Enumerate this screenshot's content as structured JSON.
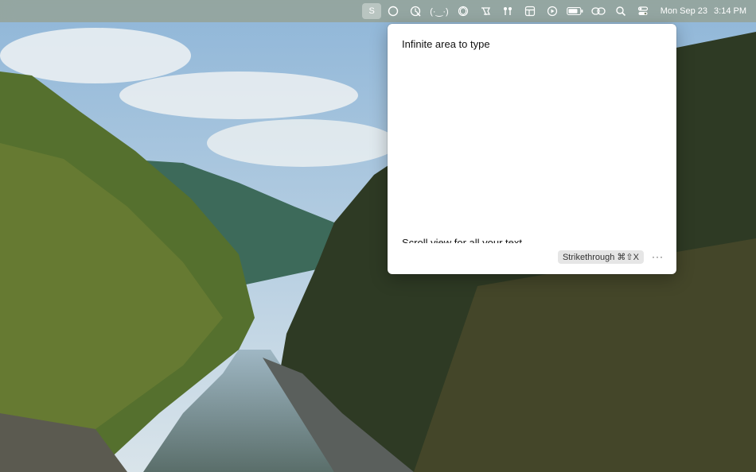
{
  "menubar": {
    "items": [
      {
        "icon": "s-app-icon",
        "label": "S",
        "active": true
      },
      {
        "icon": "circle-icon"
      },
      {
        "icon": "cursor-clock-icon"
      },
      {
        "icon": "ascii-face-icon",
        "label": "(·‿·)"
      },
      {
        "icon": "openai-icon"
      },
      {
        "icon": "flag-icon"
      },
      {
        "icon": "airpods-icon"
      },
      {
        "icon": "window-grid-icon"
      },
      {
        "icon": "play-circle-icon"
      },
      {
        "icon": "battery-icon"
      },
      {
        "icon": "link-icon"
      },
      {
        "icon": "search-icon"
      },
      {
        "icon": "control-center-icon"
      }
    ],
    "date": "Mon Sep 23",
    "time": "3:14 PM"
  },
  "popover": {
    "line1": "Infinite area to type",
    "line2": "Scroll view for all your text",
    "shortcut_label": "Strikethrough ⌘⇧X",
    "more_label": "···"
  }
}
